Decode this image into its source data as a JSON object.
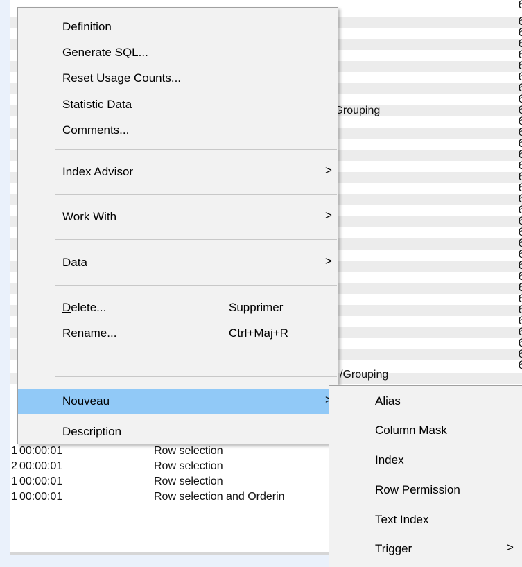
{
  "menu": {
    "items": [
      {
        "label": "Definition"
      },
      {
        "label": "Generate SQL..."
      },
      {
        "label": "Reset Usage Counts..."
      },
      {
        "label": "Statistic Data"
      },
      {
        "label": "Comments..."
      },
      {
        "label": "Index Advisor",
        "submenu": true
      },
      {
        "label": "Work With",
        "submenu": true
      },
      {
        "label": "Data",
        "submenu": true
      },
      {
        "label_first": "D",
        "label_rest": "elete...",
        "shortcut": "Supprimer"
      },
      {
        "label_first": "R",
        "label_rest": "ename...",
        "shortcut": "Ctrl+Maj+R"
      },
      {
        "label": "Nouveau",
        "submenu": true,
        "highlighted": true
      },
      {
        "label": "Description"
      }
    ],
    "arrow_glyph": ">"
  },
  "submenu": {
    "items": [
      {
        "label": "Alias"
      },
      {
        "label": "Column Mask"
      },
      {
        "label": "Index"
      },
      {
        "label": "Row Permission"
      },
      {
        "label": "Text Index"
      },
      {
        "label": "Trigger",
        "submenu": true
      }
    ]
  },
  "grid": {
    "right_glyph": "6",
    "partial_grouping_1": "/Grouping",
    "partial_grouping_2": "/Grouping",
    "bottom_rows": [
      {
        "count": "1",
        "time": "00:00:01",
        "reason": "Row selection"
      },
      {
        "count": "2",
        "time": "00:00:01",
        "reason": "Row selection"
      },
      {
        "count": "1",
        "time": "00:00:01",
        "reason": "Row selection"
      },
      {
        "count": "1",
        "time": "00:00:01",
        "reason": "Row selection and Orderin"
      }
    ]
  },
  "colors": {
    "highlight": "#91c9f7",
    "menu_bg": "#f2f2f2",
    "alt_row": "#ececec"
  }
}
